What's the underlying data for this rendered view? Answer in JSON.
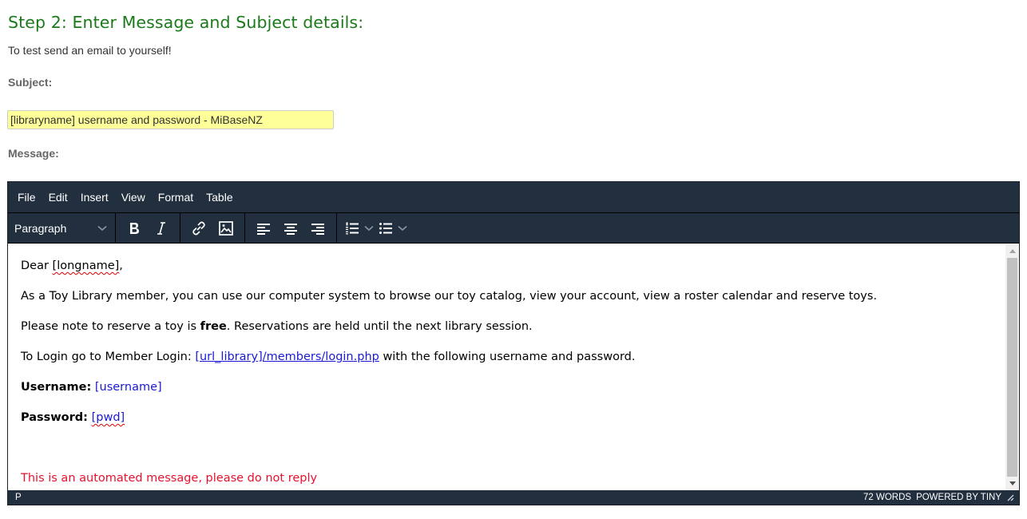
{
  "page": {
    "heading": "Step 2: Enter Message and Subject details:",
    "subtitle": "To test send an email to yourself!",
    "subject_label": "Subject:",
    "subject_value": "[libraryname] username and password - MiBaseNZ",
    "message_label": "Message:"
  },
  "editor": {
    "menubar": [
      "File",
      "Edit",
      "Insert",
      "View",
      "Format",
      "Table"
    ],
    "toolbar": {
      "block_format": "Paragraph",
      "buttons": [
        "bold-icon",
        "italic-icon",
        "link-icon",
        "image-icon",
        "align-left-icon",
        "align-center-icon",
        "align-right-icon",
        "numbered-list-icon",
        "bullet-list-icon"
      ]
    },
    "content": {
      "greeting_prefix": "Dear ",
      "greeting_var": "[longname]",
      "greeting_suffix": ",",
      "para1": "As a Toy Library member, you can use our computer system to browse our toy catalog, view your account, view a roster calendar and reserve toys.",
      "para2_prefix": "Please note to reserve a toy is ",
      "para2_bold": "free",
      "para2_suffix": ". Reservations are held until the next library session.",
      "para3_prefix": "To Login go to Member Login: ",
      "para3_link": "[url_library]/members/login.php",
      "para3_suffix": " with the following username and password.",
      "username_label": "Username:",
      "username_value": "[username]",
      "password_label": "Password:",
      "password_value": "[pwd]",
      "footer_note": "This is an automated message, please do not reply"
    },
    "statusbar": {
      "path": "P",
      "word_count": "72 WORDS",
      "branding": "POWERED BY TINY"
    }
  },
  "colors": {
    "heading": "#1a7a1a",
    "editor_chrome": "#222f3e",
    "subject_bg": "#ffff99",
    "link": "#1a1ad6",
    "note": "#e8112d"
  }
}
